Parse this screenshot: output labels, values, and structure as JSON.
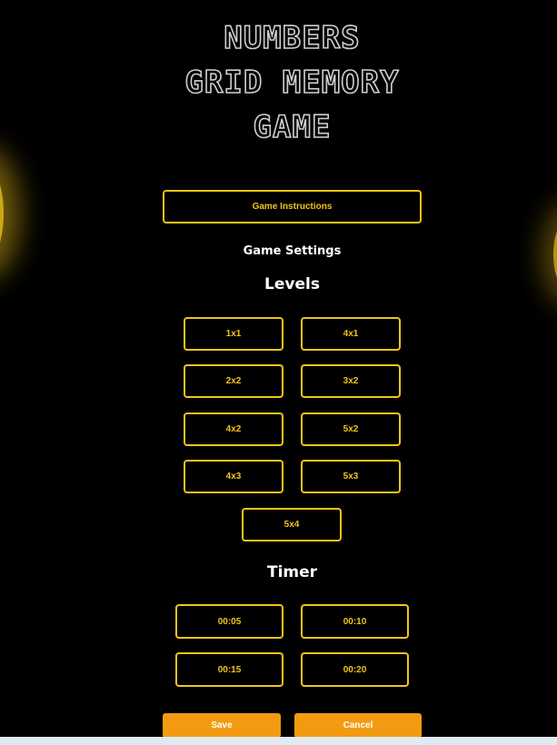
{
  "title": {
    "line1": "NUMBERS",
    "line2": "GRID MEMORY",
    "line3": "GAME"
  },
  "instructions_label": "Game Instructions",
  "settings_heading": "Game Settings",
  "levels": {
    "heading": "Levels",
    "options": [
      "1x1",
      "4x1",
      "2x2",
      "3x2",
      "4x2",
      "5x2",
      "4x3",
      "5x3",
      "5x4"
    ]
  },
  "timer": {
    "heading": "Timer",
    "options": [
      "00:05",
      "00:10",
      "00:15",
      "00:20"
    ]
  },
  "actions": {
    "save_label": "Save",
    "cancel_label": "Cancel"
  },
  "colors": {
    "accent": "#f0c419",
    "button_fill": "#f29b12",
    "background": "#000000"
  }
}
